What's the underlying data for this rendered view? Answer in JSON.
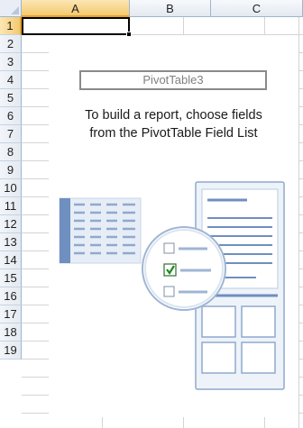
{
  "columns": [
    {
      "label": "A",
      "active": true
    },
    {
      "label": "B",
      "active": false
    },
    {
      "label": "C",
      "active": false
    }
  ],
  "rows": [
    "1",
    "2",
    "3",
    "4",
    "5",
    "6",
    "7",
    "8",
    "9",
    "10",
    "11",
    "12",
    "13",
    "14",
    "15",
    "16",
    "17",
    "18",
    "19"
  ],
  "active_row": "1",
  "pivot": {
    "name": "PivotTable3",
    "instruction_line1": "To build a report, choose fields",
    "instruction_line2": "from the PivotTable Field List"
  },
  "colors": {
    "header_border": "#9eb6ce",
    "active_header": "#f4c96f",
    "gridline": "#d4d4d4",
    "illustration_blue": "#8fa9cd"
  },
  "icons": {
    "corner": "select-all-triangle-icon",
    "illustration": "pivot-field-list-illustration-icon",
    "checkbox_checked": "checkbox-checked-icon",
    "checkbox_unchecked": "checkbox-unchecked-icon"
  }
}
